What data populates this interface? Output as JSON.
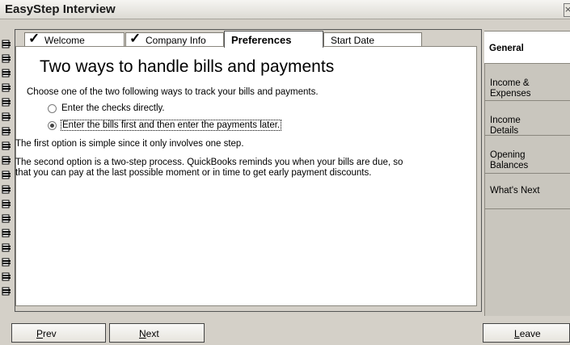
{
  "window": {
    "title": "EasyStep Interview",
    "close_glyph": "×"
  },
  "tabs": [
    {
      "label": "Welcome",
      "checked": true
    },
    {
      "label": "Company Info",
      "checked": true
    },
    {
      "label": "Preferences",
      "checked": false,
      "active": true
    },
    {
      "label": "Start Date",
      "checked": false
    }
  ],
  "content": {
    "heading": "Two ways to handle bills and payments",
    "intro": "Choose one of the two following ways to track your bills and payments.",
    "options": [
      {
        "label": "Enter the checks directly.",
        "selected": false
      },
      {
        "label": "Enter the bills first and then enter the payments later.",
        "selected": true
      }
    ],
    "para1": "The first option is simple since it only involves one step.",
    "para2_line1": "The second option is a two-step process. QuickBooks reminds you when your bills are due, so",
    "para2_line2": "that you can pay at the last possible moment or in time to get early payment discounts."
  },
  "sidebar": {
    "items": [
      {
        "label": "General",
        "active": true
      },
      {
        "label": "Income &\nExpenses"
      },
      {
        "label": "Income\nDetails"
      },
      {
        "label": "Opening\nBalances"
      },
      {
        "label": "What's Next"
      }
    ]
  },
  "buttons": {
    "prev": {
      "first": "P",
      "rest": "rev"
    },
    "next": {
      "first": "N",
      "rest": "ext"
    },
    "leave": {
      "first": "L",
      "rest": "eave"
    }
  }
}
